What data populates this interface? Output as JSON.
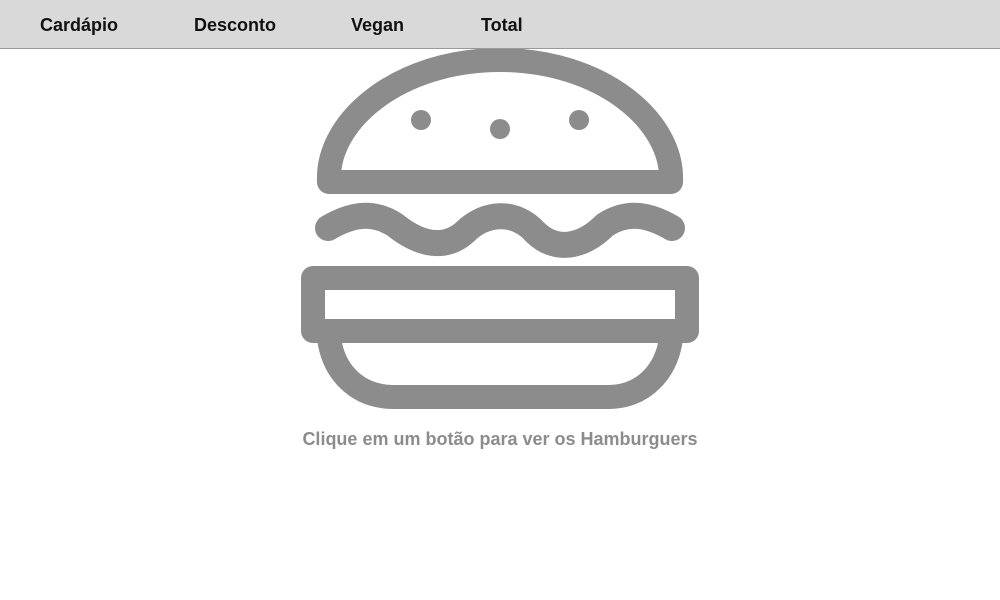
{
  "navbar": {
    "buttons": [
      {
        "label": "Cardápio"
      },
      {
        "label": "Desconto"
      },
      {
        "label": "Vegan"
      },
      {
        "label": "Total"
      }
    ]
  },
  "main": {
    "icon": "hamburger-icon",
    "hint": "Clique em um botão para ver os Hamburguers",
    "icon_color": "#8c8c8c"
  }
}
